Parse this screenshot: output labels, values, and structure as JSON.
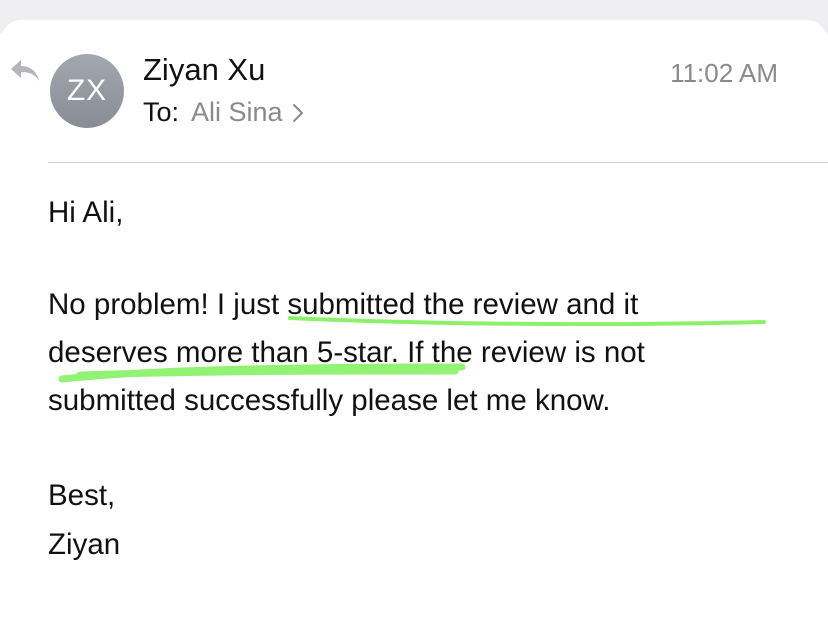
{
  "header": {
    "avatar_initials": "ZX",
    "sender_name": "Ziyan Xu",
    "timestamp": "11:02 AM",
    "to_label": "To:",
    "recipient": "Ali Sina"
  },
  "message": {
    "greeting": "Hi Ali,",
    "lines": [
      "No problem! I just submitted the review and it",
      "deserves more than 5-star. If the review is not",
      "submitted successfully please let me know."
    ],
    "signoff": "Best,",
    "signature": "Ziyan"
  },
  "icons": {
    "reply": "reply-arrow-icon",
    "chevron": "chevron-right-icon"
  },
  "colors": {
    "highlight": "#7ef05a",
    "secondary_text": "#8a8a8e",
    "avatar_bg": "#979ba4"
  }
}
